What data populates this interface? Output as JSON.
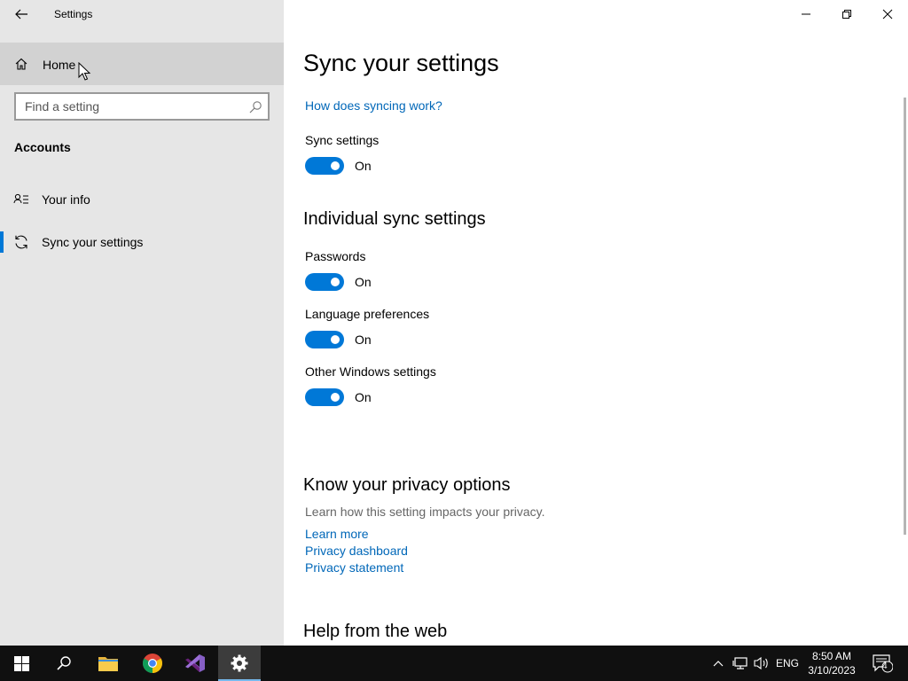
{
  "app": {
    "title": "Settings"
  },
  "sidebar": {
    "home_label": "Home",
    "search_placeholder": "Find a setting",
    "section_title": "Accounts",
    "items": [
      {
        "label": "Your info",
        "icon": "contact-card-icon"
      },
      {
        "label": "Sync your settings",
        "icon": "sync-icon",
        "selected": true
      }
    ]
  },
  "main": {
    "title": "Sync your settings",
    "how_link": "How does syncing work?",
    "sync_settings": {
      "label": "Sync settings",
      "state": "On"
    },
    "individual_heading": "Individual sync settings",
    "toggles": [
      {
        "label": "Passwords",
        "state": "On"
      },
      {
        "label": "Language preferences",
        "state": "On"
      },
      {
        "label": "Other Windows settings",
        "state": "On"
      }
    ],
    "privacy": {
      "heading": "Know your privacy options",
      "description": "Learn how this setting impacts your privacy.",
      "links": [
        "Learn more",
        "Privacy dashboard",
        "Privacy statement"
      ]
    },
    "help_heading": "Help from the web"
  },
  "taskbar": {
    "language": "ENG",
    "time": "8:50 AM",
    "date": "3/10/2023",
    "notification_count": "4"
  },
  "colors": {
    "accent": "#0078d7",
    "link": "#0067b8",
    "sidebar_bg": "#e6e6e6",
    "taskbar_bg": "#101010"
  }
}
